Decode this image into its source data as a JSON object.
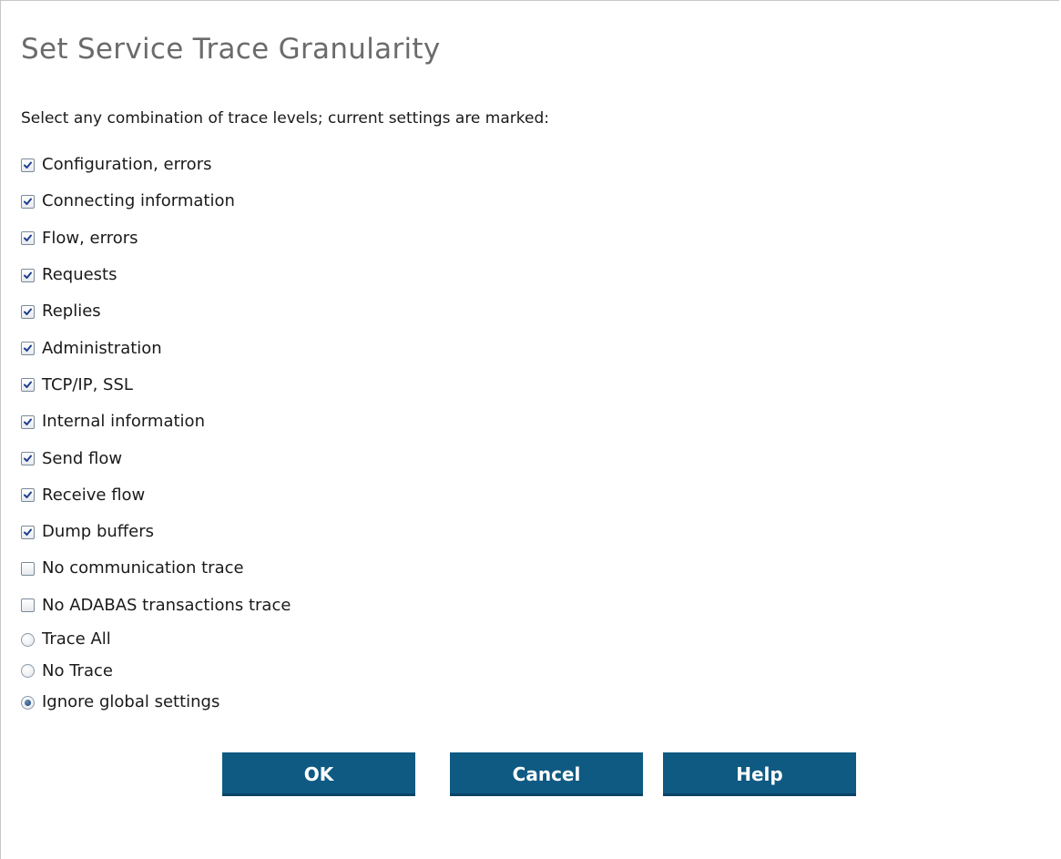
{
  "dialog": {
    "title": "Set Service Trace Granularity",
    "instruction": "Select any combination of trace levels; current settings are marked:"
  },
  "checkboxes": [
    {
      "label": "Configuration, errors",
      "checked": true
    },
    {
      "label": "Connecting information",
      "checked": true
    },
    {
      "label": "Flow, errors",
      "checked": true
    },
    {
      "label": "Requests",
      "checked": true
    },
    {
      "label": "Replies",
      "checked": true
    },
    {
      "label": "Administration",
      "checked": true
    },
    {
      "label": "TCP/IP, SSL",
      "checked": true
    },
    {
      "label": "Internal information",
      "checked": true
    },
    {
      "label": "Send flow",
      "checked": true
    },
    {
      "label": "Receive flow",
      "checked": true
    },
    {
      "label": "Dump buffers",
      "checked": true
    },
    {
      "label": "No communication trace",
      "checked": false
    },
    {
      "label": "No ADABAS transactions trace",
      "checked": false
    }
  ],
  "radios": [
    {
      "label": "Trace All",
      "selected": false
    },
    {
      "label": "No Trace",
      "selected": false
    },
    {
      "label": "Ignore global settings",
      "selected": true
    }
  ],
  "buttons": {
    "ok_label": "OK",
    "cancel_label": "Cancel",
    "help_label": "Help"
  },
  "colors": {
    "button_bg": "#0f5a83",
    "title_text": "#6b6b6b",
    "checkmark": "#1f3f8f"
  }
}
